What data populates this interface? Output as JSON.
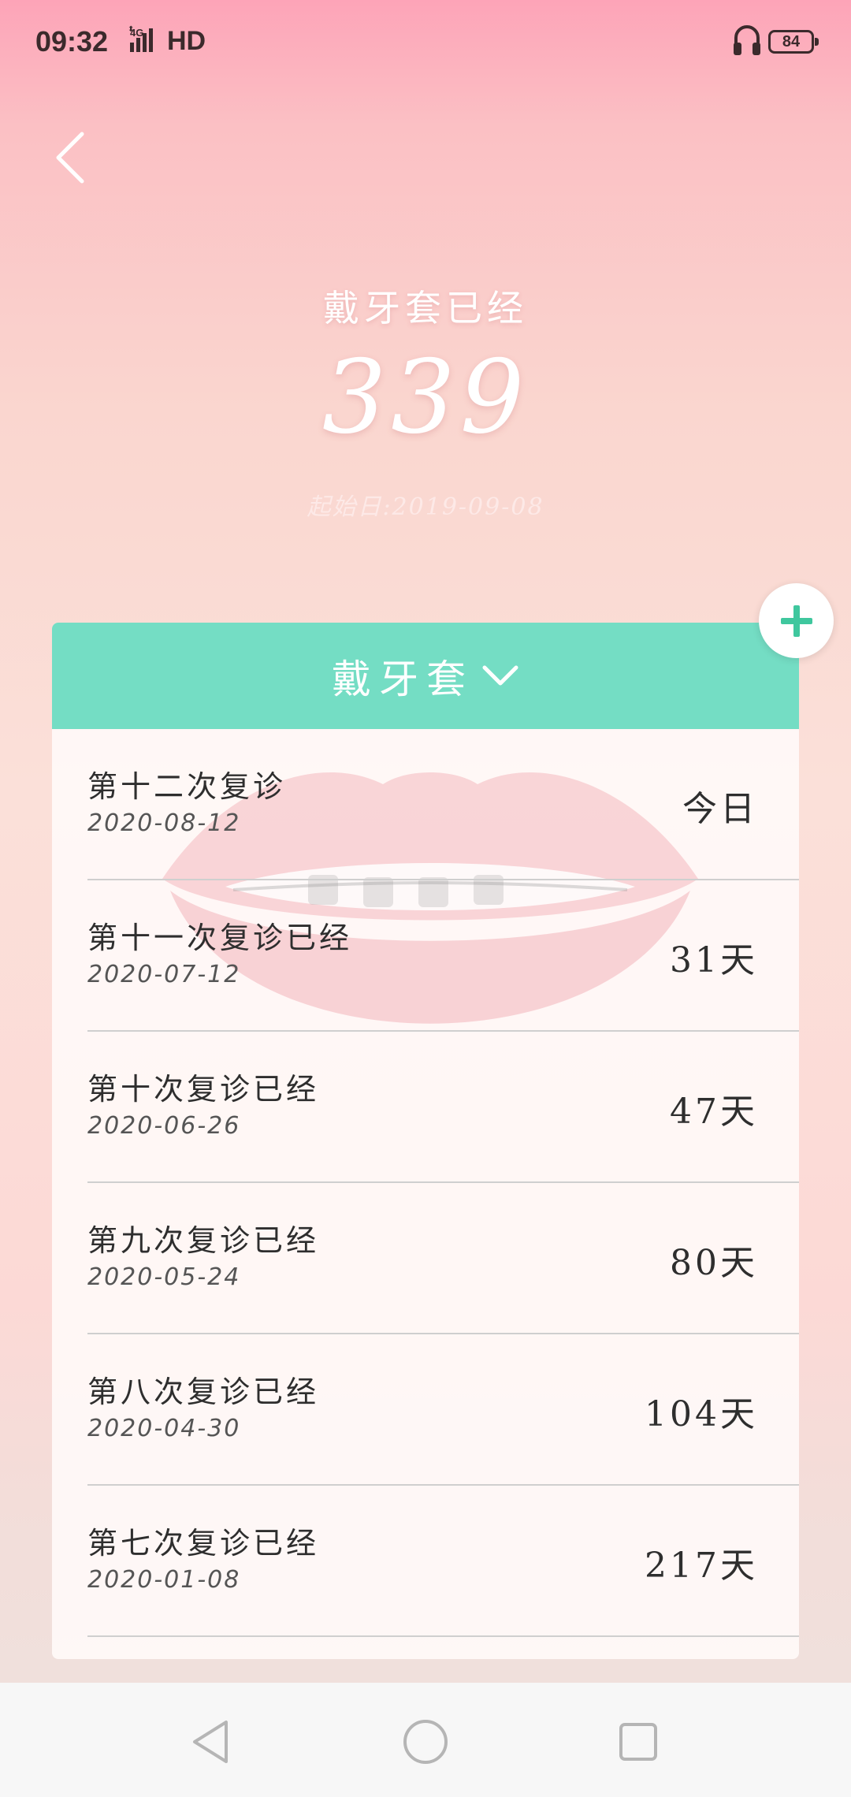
{
  "status_bar": {
    "time": "09:32",
    "network": "4G",
    "hd": "HD",
    "battery": "84",
    "icons": [
      "signal-icon",
      "headphone-icon",
      "battery-icon"
    ]
  },
  "header": {
    "back_icon": "chevron-left-icon",
    "caption": "戴牙套已经",
    "days": "339",
    "start_date": "起始日:2019-09-08"
  },
  "card": {
    "title": "戴牙套",
    "title_icon": "chevron-down-icon",
    "items": [
      {
        "title": "第十二次复诊",
        "date": "2020-08-12",
        "count": "今日"
      },
      {
        "title": "第十一次复诊已经",
        "date": "2020-07-12",
        "count": "31天"
      },
      {
        "title": "第十次复诊已经",
        "date": "2020-06-26",
        "count": "47天"
      },
      {
        "title": "第九次复诊已经",
        "date": "2020-05-24",
        "count": "80天"
      },
      {
        "title": "第八次复诊已经",
        "date": "2020-04-30",
        "count": "104天"
      },
      {
        "title": "第七次复诊已经",
        "date": "2020-01-08",
        "count": "217天"
      }
    ]
  },
  "add_button_icon": "plus-icon",
  "colors": {
    "accent": "#74ddc4",
    "plus": "#3fc79e",
    "background_top": "#fda4b8",
    "background_bottom": "#f0e0dc"
  },
  "nav_bar": {
    "icons": [
      "back-triangle-icon",
      "home-circle-icon",
      "recents-square-icon"
    ]
  }
}
